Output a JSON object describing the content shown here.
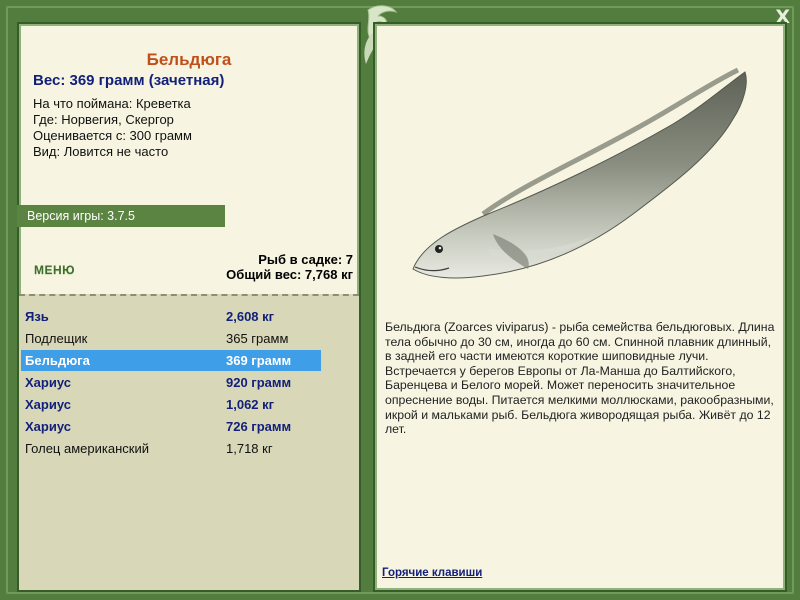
{
  "fish": {
    "name": "Бельдюга",
    "weight_line": "Вес: 369 грамм (зачетная)",
    "caught_on": "На что поймана: Креветка",
    "where": "Где: Норвегия, Скергор",
    "rated_from": "Оценивается с: 300 грамм",
    "kind": "Вид: Ловится не часто"
  },
  "version": "Версия игры: 3.7.5",
  "menu_label": "МЕНЮ",
  "cage": {
    "count": "Рыб в садке: 7",
    "total": "Общий вес: 7,768 кг"
  },
  "catch_list": [
    {
      "name": "Язь",
      "weight": "2,608 кг",
      "bold": true
    },
    {
      "name": "Подлещик",
      "weight": "365 грамм",
      "bold": false
    },
    {
      "name": "Бельдюга",
      "weight": "369 грамм",
      "bold": true,
      "selected": true
    },
    {
      "name": "Хариус",
      "weight": "920 грамм",
      "bold": true
    },
    {
      "name": "Хариус",
      "weight": "1,062 кг",
      "bold": true
    },
    {
      "name": "Хариус",
      "weight": "726 грамм",
      "bold": true
    },
    {
      "name": "Голец американский",
      "weight": "1,718 кг",
      "bold": false
    }
  ],
  "description": "Бельдюга (Zoarces viviparus) - рыба семейства бельдюговых. Длина тела обычно до 30 см, иногда до 60 см. Спинной плавник длинный, в задней его части имеются короткие шиповидные лучи. Встречается у берегов Европы от Ла-Манша до Балтийского, Баренцева и Белого морей. Может переносить значительное опреснение воды. Питается мелкими моллюсками, ракообразными, икрой и мальками рыб. Бельдюга живородящая рыба. Живёт до 12 лет.",
  "hotkeys_label": "Горячие клавиши",
  "close_label": "X",
  "colors": {
    "frame": "#527d3f",
    "panel": "#f7f5e2",
    "selected": "#3f9ee8",
    "fish_title": "#c0501a",
    "accent_blue": "#13207a"
  }
}
